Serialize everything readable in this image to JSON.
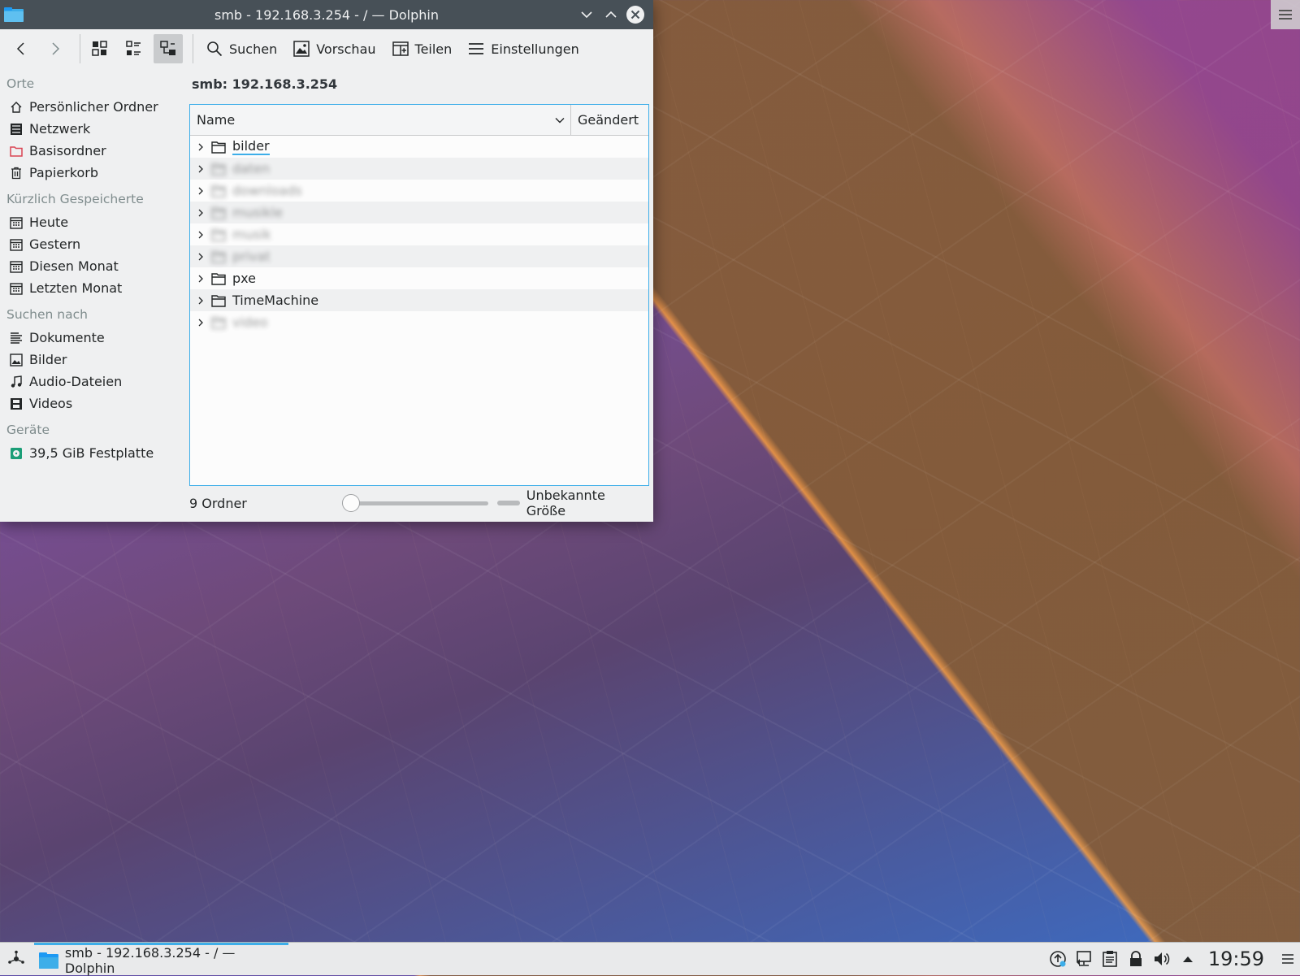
{
  "window": {
    "title": "smb - 192.168.3.254 - / — Dolphin"
  },
  "toolbar": {
    "search_label": "Suchen",
    "preview_label": "Vorschau",
    "share_label": "Teilen",
    "settings_label": "Einstellungen"
  },
  "sidebar": {
    "places_heading": "Orte",
    "places": [
      {
        "label": "Persönlicher Ordner",
        "icon": "home-icon"
      },
      {
        "label": "Netzwerk",
        "icon": "network-icon"
      },
      {
        "label": "Basisordner",
        "icon": "root-folder-icon",
        "color": "#da4453"
      },
      {
        "label": "Papierkorb",
        "icon": "trash-icon"
      }
    ],
    "recent_heading": "Kürzlich Gespeicherte",
    "recent": [
      {
        "label": "Heute",
        "icon": "calendar-icon"
      },
      {
        "label": "Gestern",
        "icon": "calendar-icon"
      },
      {
        "label": "Diesen Monat",
        "icon": "calendar-icon"
      },
      {
        "label": "Letzten Monat",
        "icon": "calendar-icon"
      }
    ],
    "search_heading": "Suchen nach",
    "search": [
      {
        "label": "Dokumente",
        "icon": "document-icon"
      },
      {
        "label": "Bilder",
        "icon": "image-icon"
      },
      {
        "label": "Audio-Dateien",
        "icon": "music-icon"
      },
      {
        "label": "Videos",
        "icon": "video-icon"
      }
    ],
    "devices_heading": "Geräte",
    "devices": [
      {
        "label": "39,5 GiB Festplatte",
        "icon": "harddisk-icon"
      }
    ]
  },
  "breadcrumb": "smb: 192.168.3.254",
  "columns": {
    "name": "Name",
    "changed": "Geändert"
  },
  "files": [
    {
      "name": "bilder",
      "blurred": false,
      "selected": true
    },
    {
      "name": "daten",
      "blurred": true
    },
    {
      "name": "downloads",
      "blurred": true
    },
    {
      "name": "musikle",
      "blurred": true
    },
    {
      "name": "musik",
      "blurred": true
    },
    {
      "name": "privat",
      "blurred": true
    },
    {
      "name": "pxe",
      "blurred": false
    },
    {
      "name": "TimeMachine",
      "blurred": false
    },
    {
      "name": "video",
      "blurred": true
    }
  ],
  "statusbar": {
    "count": "9 Ordner",
    "zoom_level": 0,
    "free_space": "Unbekannte Größe"
  },
  "taskbar": {
    "task_title": "smb - 192.168.3.254 - / — Dolphin",
    "clock": "19:59"
  },
  "colors": {
    "accent": "#3daee9",
    "titlebar": "#475057"
  }
}
